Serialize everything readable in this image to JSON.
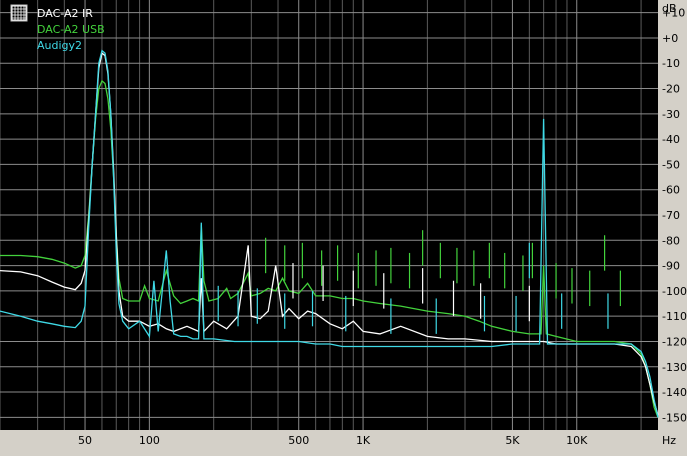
{
  "colors": {
    "background": "#000000",
    "panel": "#d4d0c8",
    "grid_major": "#8c8c8c",
    "grid_minor": "#5a5a5a",
    "axis_text": "#000000"
  },
  "legend": {
    "icon": "grid-icon",
    "items": [
      {
        "label": "DAC-A2 IR",
        "color": "#ffffff"
      },
      {
        "label": "DAC-A2 USB",
        "color": "#43d23c"
      },
      {
        "label": "Audigy2",
        "color": "#3fd9e6"
      }
    ]
  },
  "chart_data": {
    "type": "line",
    "x_scale": "log",
    "xlim": [
      20,
      24000
    ],
    "ylim": [
      -155,
      15
    ],
    "grid": true,
    "legend_position": "top-left",
    "x_unit": "Hz",
    "y_unit": "dB",
    "x_ticks": [
      {
        "value": 50,
        "label": "50"
      },
      {
        "value": 100,
        "label": "100"
      },
      {
        "value": 500,
        "label": "500"
      },
      {
        "value": 1000,
        "label": "1K"
      },
      {
        "value": 5000,
        "label": "5K"
      },
      {
        "value": 10000,
        "label": "10K"
      }
    ],
    "y_ticks": [
      {
        "value": 10,
        "label": "+10"
      },
      {
        "value": 0,
        "label": "+0"
      },
      {
        "value": -10,
        "label": "-10"
      },
      {
        "value": -20,
        "label": "-20"
      },
      {
        "value": -30,
        "label": "-30"
      },
      {
        "value": -40,
        "label": "-40"
      },
      {
        "value": -50,
        "label": "-50"
      },
      {
        "value": -60,
        "label": "-60"
      },
      {
        "value": -70,
        "label": "-70"
      },
      {
        "value": -80,
        "label": "-80"
      },
      {
        "value": -90,
        "label": "-90"
      },
      {
        "value": -100,
        "label": "-100"
      },
      {
        "value": -110,
        "label": "-110"
      },
      {
        "value": -120,
        "label": "-120"
      },
      {
        "value": -130,
        "label": "-130"
      },
      {
        "value": -140,
        "label": "-140"
      },
      {
        "value": -150,
        "label": "-150"
      }
    ],
    "series": [
      {
        "name": "DAC-A2 USB",
        "color": "#43d23c",
        "points": [
          [
            20,
            -86
          ],
          [
            25,
            -86
          ],
          [
            30,
            -86.5
          ],
          [
            35,
            -87.5
          ],
          [
            40,
            -89
          ],
          [
            45,
            -91
          ],
          [
            48,
            -90
          ],
          [
            50,
            -86
          ],
          [
            52,
            -70
          ],
          [
            54,
            -50
          ],
          [
            56,
            -32
          ],
          [
            58,
            -20
          ],
          [
            60,
            -17
          ],
          [
            62,
            -18
          ],
          [
            64,
            -24
          ],
          [
            66,
            -36
          ],
          [
            68,
            -55
          ],
          [
            70,
            -78
          ],
          [
            72,
            -95
          ],
          [
            75,
            -103
          ],
          [
            80,
            -104
          ],
          [
            90,
            -104
          ],
          [
            95,
            -98
          ],
          [
            100,
            -103
          ],
          [
            110,
            -104
          ],
          [
            120,
            -92
          ],
          [
            130,
            -102
          ],
          [
            140,
            -105
          ],
          [
            150,
            -104
          ],
          [
            160,
            -103
          ],
          [
            170,
            -104
          ],
          [
            175,
            -74
          ],
          [
            180,
            -96
          ],
          [
            190,
            -104
          ],
          [
            210,
            -103
          ],
          [
            230,
            -99
          ],
          [
            240,
            -103
          ],
          [
            260,
            -101
          ],
          [
            290,
            -93
          ],
          [
            300,
            -102
          ],
          [
            330,
            -101
          ],
          [
            360,
            -99
          ],
          [
            390,
            -100
          ],
          [
            420,
            -95
          ],
          [
            450,
            -100
          ],
          [
            500,
            -101
          ],
          [
            550,
            -97
          ],
          [
            600,
            -102
          ],
          [
            700,
            -102
          ],
          [
            800,
            -103
          ],
          [
            900,
            -103
          ],
          [
            1000,
            -104
          ],
          [
            1200,
            -105
          ],
          [
            1500,
            -106
          ],
          [
            2000,
            -108
          ],
          [
            2500,
            -109
          ],
          [
            3000,
            -110
          ],
          [
            3500,
            -112
          ],
          [
            4000,
            -114
          ],
          [
            5000,
            -116
          ],
          [
            6000,
            -117
          ],
          [
            6800,
            -117
          ],
          [
            7000,
            -90
          ],
          [
            7200,
            -117
          ],
          [
            8000,
            -118
          ],
          [
            10000,
            -120
          ],
          [
            12000,
            -120
          ],
          [
            15000,
            -120
          ],
          [
            18000,
            -121
          ],
          [
            20000,
            -125
          ],
          [
            21000,
            -130
          ],
          [
            22000,
            -137
          ],
          [
            23000,
            -146
          ],
          [
            24000,
            -150
          ]
        ]
      },
      {
        "name": "DAC-A2 IR",
        "color": "#ffffff",
        "points": [
          [
            20,
            -92
          ],
          [
            25,
            -92.5
          ],
          [
            30,
            -94
          ],
          [
            35,
            -96.5
          ],
          [
            40,
            -98.5
          ],
          [
            45,
            -99.5
          ],
          [
            48,
            -97
          ],
          [
            50,
            -92
          ],
          [
            52,
            -72
          ],
          [
            54,
            -50
          ],
          [
            56,
            -30
          ],
          [
            58,
            -12
          ],
          [
            60,
            -6
          ],
          [
            62,
            -7
          ],
          [
            64,
            -14
          ],
          [
            66,
            -30
          ],
          [
            68,
            -52
          ],
          [
            70,
            -78
          ],
          [
            72,
            -100
          ],
          [
            75,
            -110
          ],
          [
            80,
            -112
          ],
          [
            90,
            -112
          ],
          [
            100,
            -114
          ],
          [
            110,
            -113
          ],
          [
            120,
            -115
          ],
          [
            130,
            -116
          ],
          [
            150,
            -114
          ],
          [
            170,
            -116
          ],
          [
            175,
            -95
          ],
          [
            180,
            -116
          ],
          [
            200,
            -112
          ],
          [
            230,
            -115
          ],
          [
            260,
            -110
          ],
          [
            290,
            -82
          ],
          [
            300,
            -110
          ],
          [
            330,
            -111
          ],
          [
            360,
            -108
          ],
          [
            390,
            -90
          ],
          [
            420,
            -110
          ],
          [
            450,
            -107
          ],
          [
            500,
            -111
          ],
          [
            550,
            -108
          ],
          [
            600,
            -109
          ],
          [
            700,
            -113
          ],
          [
            800,
            -115
          ],
          [
            900,
            -112
          ],
          [
            1000,
            -116
          ],
          [
            1200,
            -117
          ],
          [
            1500,
            -114
          ],
          [
            2000,
            -118
          ],
          [
            2500,
            -119
          ],
          [
            3000,
            -119
          ],
          [
            4000,
            -120
          ],
          [
            5000,
            -120
          ],
          [
            6000,
            -120
          ],
          [
            7000,
            -120
          ],
          [
            8000,
            -121
          ],
          [
            10000,
            -121
          ],
          [
            12000,
            -121
          ],
          [
            15000,
            -121
          ],
          [
            18000,
            -122
          ],
          [
            20000,
            -126
          ],
          [
            21000,
            -130
          ],
          [
            22000,
            -137
          ],
          [
            23000,
            -144
          ],
          [
            24000,
            -149
          ]
        ]
      },
      {
        "name": "Audigy2",
        "color": "#3fd9e6",
        "points": [
          [
            20,
            -108
          ],
          [
            25,
            -110
          ],
          [
            30,
            -112
          ],
          [
            35,
            -113
          ],
          [
            40,
            -114
          ],
          [
            45,
            -114.5
          ],
          [
            48,
            -112
          ],
          [
            50,
            -106
          ],
          [
            52,
            -75
          ],
          [
            54,
            -50
          ],
          [
            56,
            -30
          ],
          [
            58,
            -10
          ],
          [
            60,
            -5
          ],
          [
            62,
            -6
          ],
          [
            64,
            -13
          ],
          [
            66,
            -30
          ],
          [
            68,
            -55
          ],
          [
            70,
            -85
          ],
          [
            72,
            -105
          ],
          [
            75,
            -112
          ],
          [
            80,
            -115
          ],
          [
            90,
            -112
          ],
          [
            100,
            -118
          ],
          [
            105,
            -96
          ],
          [
            110,
            -116
          ],
          [
            120,
            -84
          ],
          [
            125,
            -104
          ],
          [
            130,
            -117
          ],
          [
            140,
            -118
          ],
          [
            150,
            -118
          ],
          [
            160,
            -119
          ],
          [
            170,
            -119
          ],
          [
            175,
            -73
          ],
          [
            180,
            -119
          ],
          [
            200,
            -119
          ],
          [
            250,
            -120
          ],
          [
            300,
            -120
          ],
          [
            350,
            -120
          ],
          [
            400,
            -120
          ],
          [
            500,
            -120
          ],
          [
            600,
            -121
          ],
          [
            700,
            -121
          ],
          [
            800,
            -122
          ],
          [
            1000,
            -122
          ],
          [
            1500,
            -122
          ],
          [
            2000,
            -122
          ],
          [
            3000,
            -122
          ],
          [
            4000,
            -122
          ],
          [
            5000,
            -121
          ],
          [
            6000,
            -121
          ],
          [
            6700,
            -121
          ],
          [
            7000,
            -32
          ],
          [
            7300,
            -121
          ],
          [
            8000,
            -121
          ],
          [
            10000,
            -121
          ],
          [
            12000,
            -121
          ],
          [
            15000,
            -121
          ],
          [
            18000,
            -121
          ],
          [
            20000,
            -124
          ],
          [
            21000,
            -128
          ],
          [
            22000,
            -134
          ],
          [
            23000,
            -143
          ],
          [
            24000,
            -150
          ]
        ]
      }
    ],
    "spurs": [
      {
        "series": "DAC-A2 USB",
        "x": 350,
        "y": -93
      },
      {
        "series": "DAC-A2 USB",
        "x": 430,
        "y": -96
      },
      {
        "series": "DAC-A2 USB",
        "x": 520,
        "y": -95
      },
      {
        "series": "DAC-A2 USB",
        "x": 640,
        "y": -98
      },
      {
        "series": "DAC-A2 USB",
        "x": 760,
        "y": -96
      },
      {
        "series": "DAC-A2 USB",
        "x": 950,
        "y": -99
      },
      {
        "series": "DAC-A2 USB",
        "x": 1150,
        "y": -98
      },
      {
        "series": "DAC-A2 USB",
        "x": 1350,
        "y": -97
      },
      {
        "series": "DAC-A2 USB",
        "x": 1650,
        "y": -99
      },
      {
        "series": "DAC-A2 USB",
        "x": 1900,
        "y": -90
      },
      {
        "series": "DAC-A2 USB",
        "x": 2300,
        "y": -95
      },
      {
        "series": "DAC-A2 USB",
        "x": 2750,
        "y": -97
      },
      {
        "series": "DAC-A2 USB",
        "x": 3300,
        "y": -98
      },
      {
        "series": "DAC-A2 USB",
        "x": 3900,
        "y": -95
      },
      {
        "series": "DAC-A2 USB",
        "x": 4600,
        "y": -99
      },
      {
        "series": "DAC-A2 USB",
        "x": 5600,
        "y": -100
      },
      {
        "series": "DAC-A2 USB",
        "x": 6200,
        "y": -95
      },
      {
        "series": "DAC-A2 USB",
        "x": 8000,
        "y": -103
      },
      {
        "series": "DAC-A2 USB",
        "x": 9500,
        "y": -105
      },
      {
        "series": "DAC-A2 USB",
        "x": 11500,
        "y": -106
      },
      {
        "series": "DAC-A2 USB",
        "x": 13500,
        "y": -92
      },
      {
        "series": "DAC-A2 USB",
        "x": 16000,
        "y": -106
      },
      {
        "series": "DAC-A2 IR",
        "x": 470,
        "y": -103
      },
      {
        "series": "DAC-A2 IR",
        "x": 650,
        "y": -104
      },
      {
        "series": "DAC-A2 IR",
        "x": 900,
        "y": -106
      },
      {
        "series": "DAC-A2 IR",
        "x": 1250,
        "y": -107
      },
      {
        "series": "DAC-A2 IR",
        "x": 1900,
        "y": -105
      },
      {
        "series": "DAC-A2 IR",
        "x": 2650,
        "y": -110
      },
      {
        "series": "DAC-A2 IR",
        "x": 3550,
        "y": -111
      },
      {
        "series": "DAC-A2 IR",
        "x": 6000,
        "y": -112
      },
      {
        "series": "Audigy2",
        "x": 210,
        "y": -112
      },
      {
        "series": "Audigy2",
        "x": 260,
        "y": -114
      },
      {
        "series": "Audigy2",
        "x": 320,
        "y": -113
      },
      {
        "series": "Audigy2",
        "x": 430,
        "y": -115
      },
      {
        "series": "Audigy2",
        "x": 580,
        "y": -114
      },
      {
        "series": "Audigy2",
        "x": 830,
        "y": -116
      },
      {
        "series": "Audigy2",
        "x": 1350,
        "y": -117
      },
      {
        "series": "Audigy2",
        "x": 2200,
        "y": -117
      },
      {
        "series": "Audigy2",
        "x": 3700,
        "y": -116
      },
      {
        "series": "Audigy2",
        "x": 5200,
        "y": -116
      },
      {
        "series": "Audigy2",
        "x": 6000,
        "y": -95
      },
      {
        "series": "Audigy2",
        "x": 8500,
        "y": -115
      },
      {
        "series": "Audigy2",
        "x": 14000,
        "y": -115
      }
    ]
  }
}
